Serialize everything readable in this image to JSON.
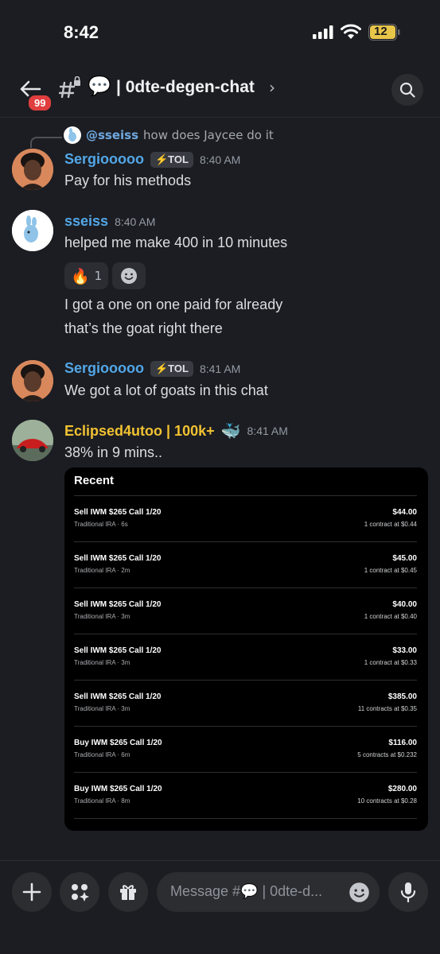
{
  "status_bar": {
    "time": "8:42",
    "battery": "12"
  },
  "header": {
    "back_badge": "99",
    "channel_emoji": "💬",
    "channel_name": "| 0dte-degen-chat",
    "chevron": "›"
  },
  "messages": {
    "reply": {
      "user": "@sseiss",
      "text": "how does Jaycee do it"
    },
    "m1": {
      "user": "Sergiooooo",
      "tag": "⚡TOL",
      "time": "8:40 AM",
      "text": "Pay for his methods"
    },
    "m2": {
      "user": "sseiss",
      "time": "8:40 AM",
      "lines": [
        "helped me make 400 in 10 minutes"
      ],
      "reaction_emoji": "🔥",
      "reaction_count": "1"
    },
    "m2b": {
      "lines": [
        "I got a one on one paid for already",
        "that’s the goat right there"
      ]
    },
    "m3": {
      "user": "Sergiooooo",
      "tag": "⚡TOL",
      "time": "8:41 AM",
      "text": "We got a lot of goats in this chat"
    },
    "m4": {
      "user": "Eclipsed4utoo | 100k+",
      "emoji": "🐳",
      "time": "8:41 AM",
      "text": "38% in 9 mins.."
    }
  },
  "trade_card": {
    "title": "Recent",
    "rows": [
      {
        "title": "Sell IWM $265 Call 1/20",
        "sub": "Traditional IRA · 6s",
        "amount": "$44.00",
        "detail": "1 contract at $0.44"
      },
      {
        "title": "Sell IWM $265 Call 1/20",
        "sub": "Traditional IRA · 2m",
        "amount": "$45.00",
        "detail": "1 contract at $0.45"
      },
      {
        "title": "Sell IWM $265 Call 1/20",
        "sub": "Traditional IRA · 3m",
        "amount": "$40.00",
        "detail": "1 contract at $0.40"
      },
      {
        "title": "Sell IWM $265 Call 1/20",
        "sub": "Traditional IRA · 3m",
        "amount": "$33.00",
        "detail": "1 contract at $0.33"
      },
      {
        "title": "Sell IWM $265 Call 1/20",
        "sub": "Traditional IRA · 3m",
        "amount": "$385.00",
        "detail": "11 contracts at $0.35"
      },
      {
        "title": "Buy IWM $265 Call 1/20",
        "sub": "Traditional IRA · 6m",
        "amount": "$116.00",
        "detail": "5 contracts at $0.232"
      },
      {
        "title": "Buy IWM $265 Call 1/20",
        "sub": "Traditional IRA · 8m",
        "amount": "$280.00",
        "detail": "10 contracts at $0.28"
      }
    ]
  },
  "composer": {
    "placeholder": "Message #💬 | 0dte-d..."
  }
}
